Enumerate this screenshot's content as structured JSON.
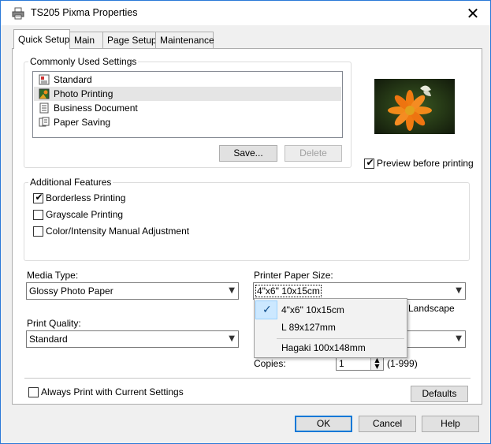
{
  "window": {
    "title": "TS205 Pixma Properties",
    "close_glyph": "✕"
  },
  "tabs": [
    {
      "label": "Quick Setup",
      "active": true
    },
    {
      "label": "Main",
      "active": false
    },
    {
      "label": "Page Setup",
      "active": false
    },
    {
      "label": "Maintenance",
      "active": false
    }
  ],
  "commonly_used": {
    "group_label": "Commonly Used Settings",
    "items": [
      {
        "label": "Standard",
        "icon": "standard-settings-icon",
        "selected": false
      },
      {
        "label": "Photo Printing",
        "icon": "photo-printing-icon",
        "selected": true
      },
      {
        "label": "Business Document",
        "icon": "business-document-icon",
        "selected": false
      },
      {
        "label": "Paper Saving",
        "icon": "paper-saving-icon",
        "selected": false
      }
    ],
    "save_label": "Save...",
    "delete_label": "Delete"
  },
  "preview": {
    "checkbox_label": "Preview before printing",
    "checked": true
  },
  "additional_features": {
    "group_label": "Additional Features",
    "items": [
      {
        "label": "Borderless Printing",
        "checked": true
      },
      {
        "label": "Grayscale Printing",
        "checked": false
      },
      {
        "label": "Color/Intensity Manual Adjustment",
        "checked": false
      }
    ]
  },
  "media_type": {
    "label": "Media Type:",
    "value": "Glossy Photo Paper"
  },
  "print_quality": {
    "label": "Print Quality:",
    "value": "Standard"
  },
  "paper_size": {
    "label": "Printer Paper Size:",
    "value": "4\"x6\" 10x15cm",
    "options": [
      {
        "label": "4\"x6\" 10x15cm",
        "checked": true
      },
      {
        "label": "L 89x127mm",
        "checked": false
      },
      {
        "label": "Hagaki 100x148mm",
        "checked": false
      }
    ],
    "check_glyph": "✓"
  },
  "orientation": {
    "landscape_label": "Landscape"
  },
  "copies": {
    "label": "Copies:",
    "value": "1",
    "range": "(1-999)"
  },
  "always_print": {
    "label": "Always Print with Current Settings",
    "checked": false
  },
  "defaults_label": "Defaults",
  "footer": {
    "ok_label": "OK",
    "cancel_label": "Cancel",
    "help_label": "Help"
  }
}
